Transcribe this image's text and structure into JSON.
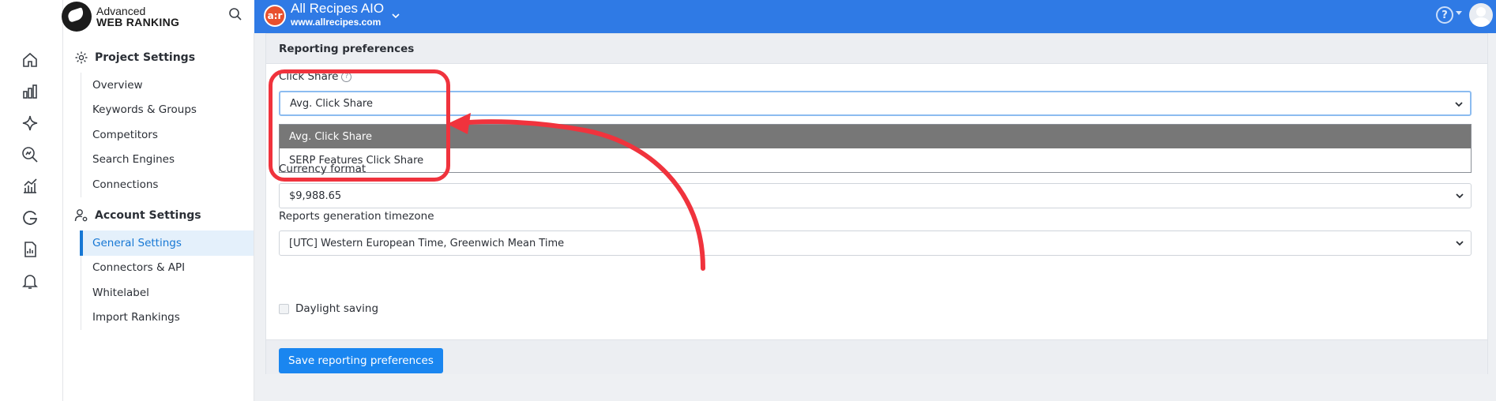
{
  "brand": {
    "line1": "Advanced",
    "line2": "WEB RANKING"
  },
  "rail_icons": [
    "home-icon",
    "bar-chart-icon",
    "sparkle-icon",
    "search-analytics-icon",
    "trend-chart-icon",
    "google-icon",
    "report-icon",
    "bell-icon"
  ],
  "sidebar": {
    "project_title": "Project Settings",
    "project_items": [
      {
        "label": "Overview"
      },
      {
        "label": "Keywords & Groups"
      },
      {
        "label": "Competitors"
      },
      {
        "label": "Search Engines"
      },
      {
        "label": "Connections"
      }
    ],
    "account_title": "Account Settings",
    "account_items": [
      {
        "label": "General Settings",
        "active": true
      },
      {
        "label": "Connectors & API"
      },
      {
        "label": "Whitelabel"
      },
      {
        "label": "Import Rankings"
      }
    ]
  },
  "topbar": {
    "project_badge": "a:r",
    "project_name": "All Recipes AIO",
    "project_url": "www.allrecipes.com",
    "help": "?"
  },
  "panel": {
    "title": "Reporting preferences",
    "click_share": {
      "label": "Click Share",
      "value": "Avg. Click Share",
      "options": [
        "Avg. Click Share",
        "SERP Features Click Share"
      ],
      "selected_index": 0
    },
    "currency": {
      "label": "Currency format",
      "value": "$9,988.65"
    },
    "timezone": {
      "label": "Reports generation timezone",
      "value": "[UTC] Western European Time, Greenwich Mean Time"
    },
    "daylight": {
      "label": "Daylight saving",
      "checked": false
    },
    "save_label": "Save reporting preferences"
  },
  "colors": {
    "topbar": "#2f7ae5",
    "accent": "#1677d4",
    "annotation": "#f0333d",
    "selected_option": "#777777"
  }
}
